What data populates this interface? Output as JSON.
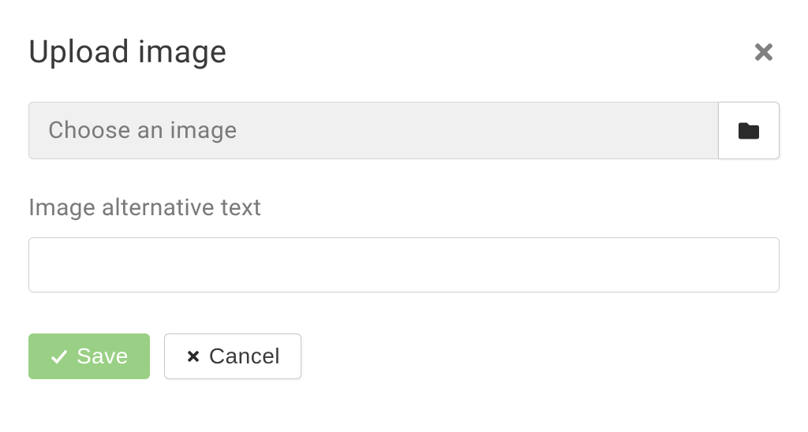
{
  "modal": {
    "title": "Upload image"
  },
  "file_chooser": {
    "placeholder": "Choose an image",
    "value": ""
  },
  "alt_text": {
    "label": "Image alternative text",
    "value": ""
  },
  "buttons": {
    "save_label": "Save",
    "cancel_label": "Cancel"
  },
  "colors": {
    "save_bg": "#9ad085",
    "text_muted": "#7a7a7a",
    "border": "#d0d0d0"
  }
}
